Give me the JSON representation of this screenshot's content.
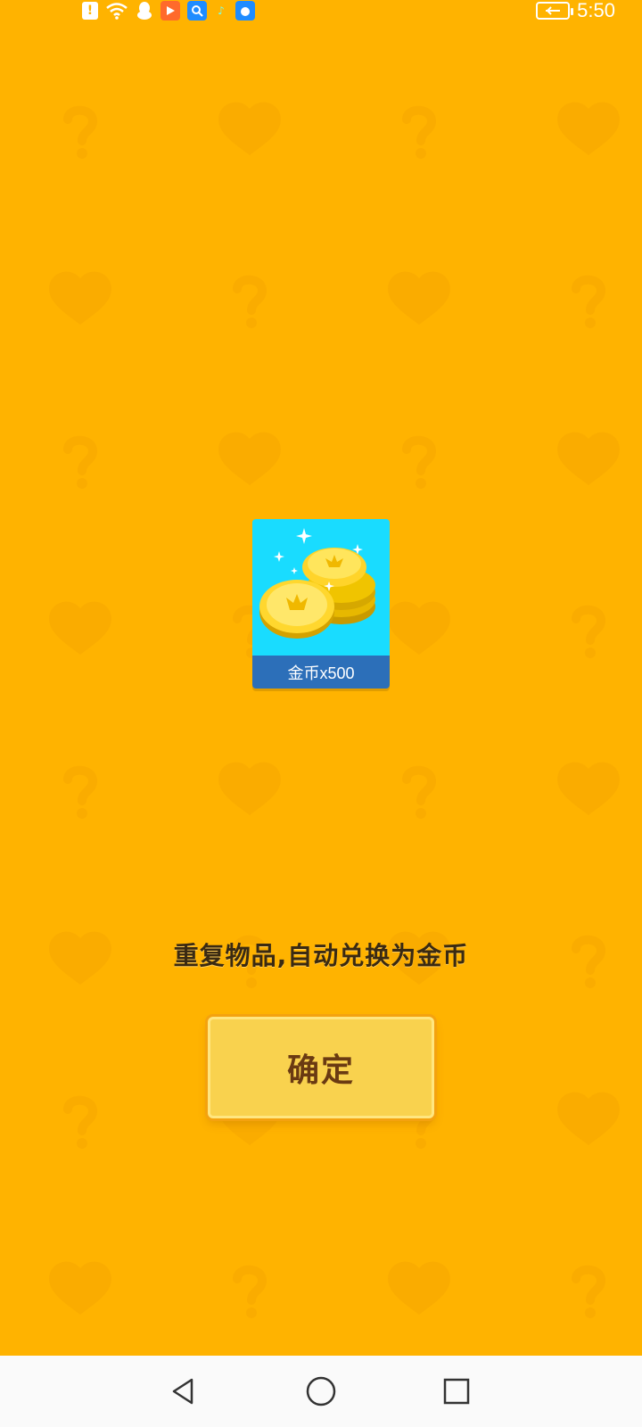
{
  "status_bar": {
    "time": "5:50",
    "icons": [
      "alert-icon",
      "wifi-icon",
      "qq-icon",
      "video-icon",
      "search-icon",
      "music-icon",
      "browser-icon",
      "battery-icon"
    ]
  },
  "reward": {
    "label": "金币x500",
    "icon": "coin-stack-icon"
  },
  "message": "重复物品,自动兑换为金币",
  "confirm_button": {
    "label": "确定"
  },
  "nav_bar": {
    "icons": [
      "back-icon",
      "home-icon",
      "recents-icon"
    ]
  },
  "colors": {
    "background": "#FFB300",
    "card_bg": "#19DCFF",
    "card_label_bg": "#2C6FB9",
    "button_bg": "#F9D24E",
    "button_text": "#6A3A12",
    "message_text": "#3A2A12"
  }
}
